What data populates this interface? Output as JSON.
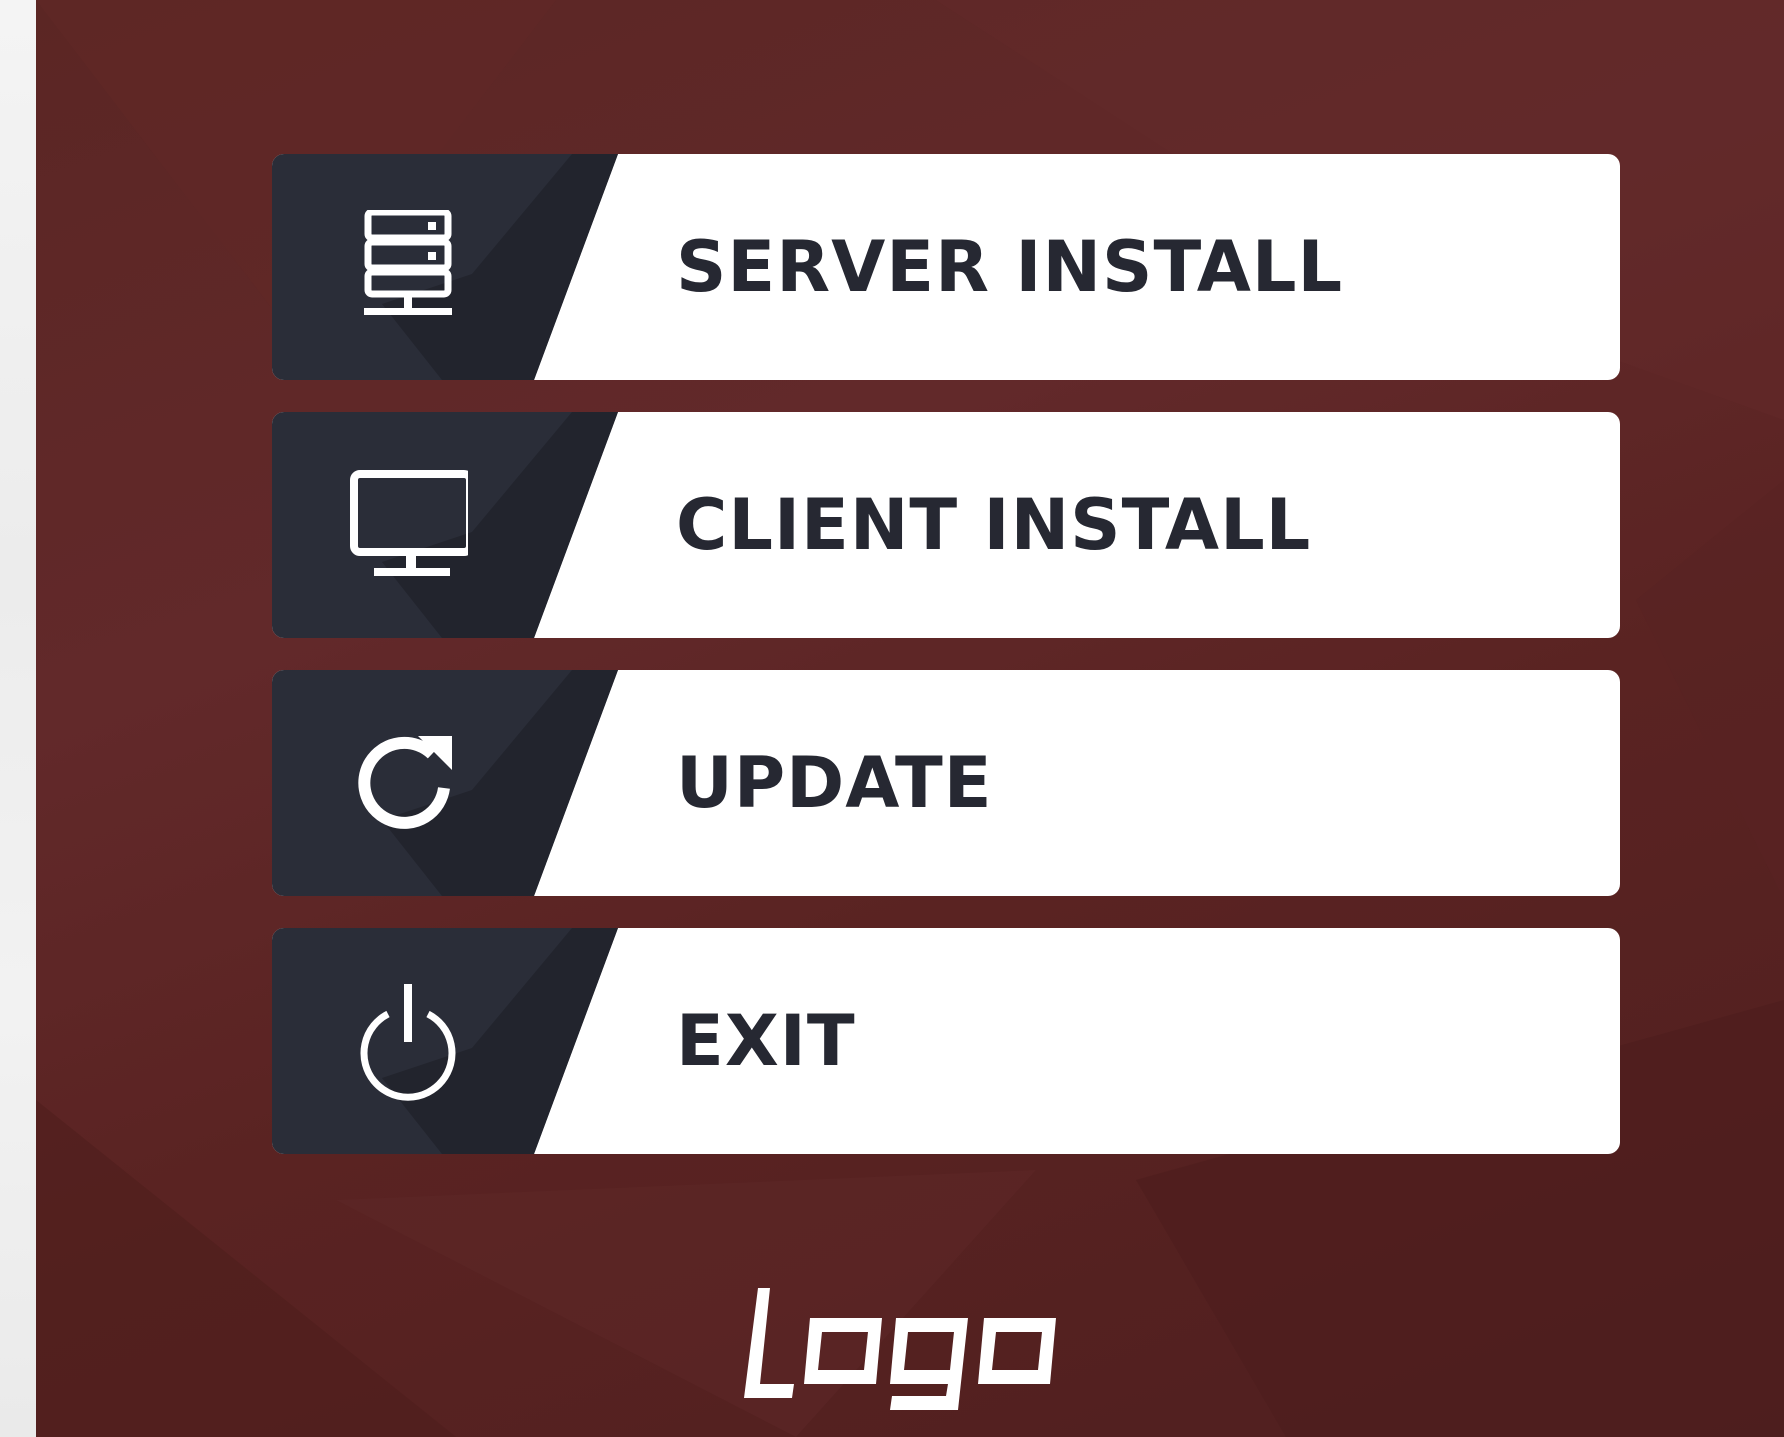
{
  "menu": {
    "items": [
      {
        "label": "SERVER INSTALL",
        "icon": "server-icon"
      },
      {
        "label": "CLIENT INSTALL",
        "icon": "monitor-icon"
      },
      {
        "label": "UPDATE",
        "icon": "refresh-icon"
      },
      {
        "label": "EXIT",
        "icon": "power-icon"
      }
    ]
  },
  "brand": {
    "logo_text": "logo"
  },
  "colors": {
    "panel_background": "#5b2624",
    "icon_block": "#2a2d38",
    "icon_shadow": "#22242d",
    "button_face": "#ffffff",
    "label_text": "#262832"
  }
}
